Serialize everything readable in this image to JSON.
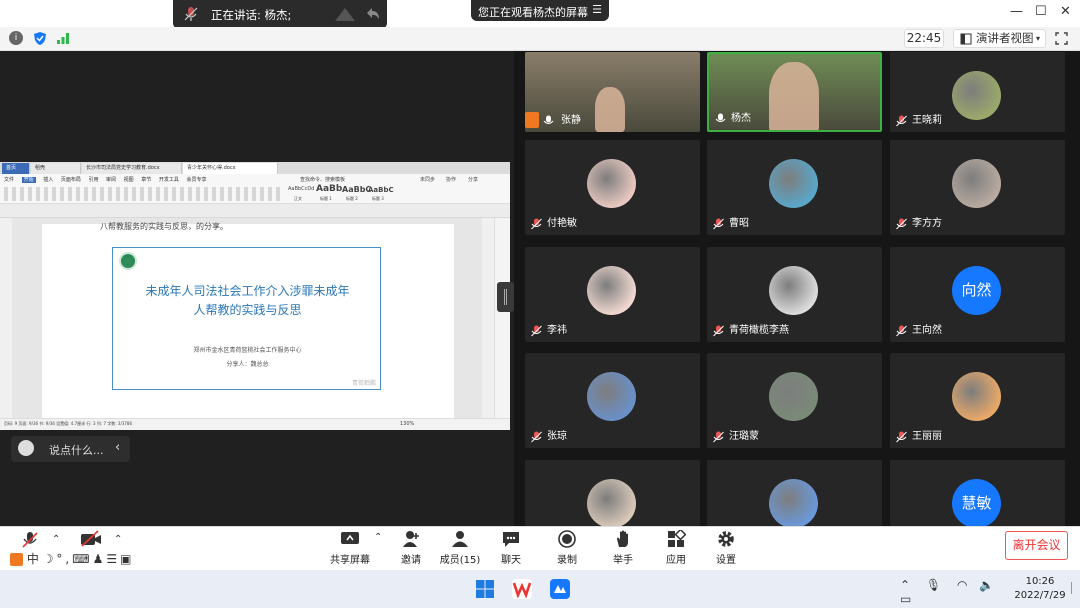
{
  "speaking": {
    "label": "正在讲话: 杨杰;"
  },
  "watching": {
    "label": "您正在观看杨杰的屏幕",
    "menu_icon": "menu-icon"
  },
  "window_controls": {
    "minimize": "—",
    "maximize": "☐",
    "close": "✕"
  },
  "status": {
    "time": "22:45",
    "view_label": "演讲者视图"
  },
  "shared_doc": {
    "tabs": [
      "首页",
      "稻壳",
      "长沙市司法局党史学习教育.docx",
      "青少年关怀心得.docx"
    ],
    "menus": [
      "文件",
      "开始",
      "插入",
      "页面布局",
      "引用",
      "审阅",
      "视图",
      "章节",
      "开发工具",
      "会员专享"
    ],
    "search_placeholder": "查找命令、搜索模板",
    "ribbon_right": [
      "未同步",
      "协作",
      "分享"
    ],
    "styles": [
      "AaBbCcDd",
      "AaBb",
      "AaBbC",
      "AaBbC"
    ],
    "style_names": [
      "正文",
      "标题 1",
      "标题 2",
      "标题 3"
    ],
    "top_line": "八帮教服务的实践与反思，的分享。",
    "slide_title_line1": "未成年人司法社会工作介入涉罪未成年",
    "slide_title_line2": "人帮教的实践与反思",
    "slide_org": "郑州市金水区青荷篮桃社会工作服务中心",
    "slide_speaker": "分享人：魏总总",
    "slide_watermark": "青荷鹤鹏",
    "status_left": "页码: 9   页面: 9/36   节: 9/36   设置值: 4.7厘米   行: 3   列: 7   字数: 3/3786",
    "status_right": "130%"
  },
  "chat": {
    "placeholder": "说点什么...",
    "smiley": "smiley-icon",
    "collapse": "chevron-left-icon"
  },
  "participants": [
    {
      "name": "张静",
      "mic": "on",
      "tile": "video",
      "bg": "#8a7d6a"
    },
    {
      "name": "杨杰",
      "mic": "on",
      "tile": "video",
      "bg": "#6f8c55"
    },
    {
      "name": "王晓莉",
      "mic": "off",
      "tile": "avatar",
      "bg": "#9aa86a"
    },
    {
      "name": "付艳敏",
      "mic": "off",
      "tile": "avatar",
      "bg": "#e8c8c0"
    },
    {
      "name": "曹昭",
      "mic": "off",
      "tile": "avatar",
      "bg": "#5aa6c8"
    },
    {
      "name": "李方方",
      "mic": "off",
      "tile": "avatar",
      "bg": "#b8aaa0"
    },
    {
      "name": "李祎",
      "mic": "off",
      "tile": "avatar",
      "bg": "#f0d8d0"
    },
    {
      "name": "青荷橄榄李燕",
      "mic": "off",
      "tile": "avatar",
      "bg": "#dcdcdc"
    },
    {
      "name": "王向然",
      "mic": "off",
      "tile": "text",
      "bg": "#1677ff",
      "initials": "向然"
    },
    {
      "name": "张琼",
      "mic": "off",
      "tile": "avatar",
      "bg": "#6a90c8"
    },
    {
      "name": "汪璐蒙",
      "mic": "off",
      "tile": "avatar",
      "bg": "#7a8a78"
    },
    {
      "name": "王丽丽",
      "mic": "off",
      "tile": "avatar",
      "bg": "#e8a868"
    },
    {
      "name": "",
      "mic": "off",
      "tile": "avatar",
      "bg": "#d8c8b8"
    },
    {
      "name": "",
      "mic": "off",
      "tile": "avatar",
      "bg": "#6a98d8"
    },
    {
      "name": "",
      "mic": "off",
      "tile": "text",
      "bg": "#1677ff",
      "initials": "慧敏"
    }
  ],
  "toolbar": {
    "share": "共享屏幕",
    "invite": "邀请",
    "members": "成员(15)",
    "chat": "聊天",
    "record": "录制",
    "raise_hand": "举手",
    "apps": "应用",
    "settings": "设置",
    "leave": "离开会议",
    "ime": "中"
  },
  "taskbar": {
    "time": "10:26",
    "date": "2022/7/29"
  },
  "colors": {
    "accent": "#1677ff",
    "leave": "#e33333",
    "dark_bg": "#161616"
  }
}
